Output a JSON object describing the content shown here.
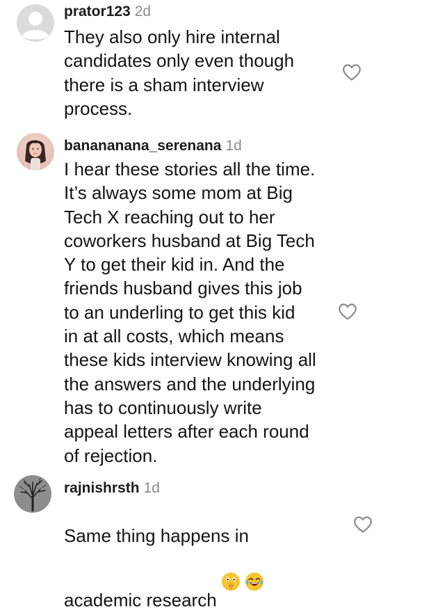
{
  "comments": [
    {
      "username": "prator123",
      "time": "2d",
      "text": "They also only hire internal\ncandidates only even though\nthere is a sham interview\nprocess.",
      "avatar_icon": "default-avatar-icon",
      "like_icon": "heart-outline-icon"
    },
    {
      "username": "banananana_serenana",
      "time": "1d",
      "text": "I hear these stories all the time.\nIt’s always some mom at Big\nTech X reaching out to her\ncoworkers husband at Big Tech\nY to get their kid in. And the\nfriends husband gives this job\nto an underling to get this kid\nin at all costs, which means\nthese kids interview knowing all\nthe answers and the underlying\nhas to continuously write\nappeal letters after each round\nof rejection.",
      "avatar_icon": "profile-photo-avatar",
      "like_icon": "heart-outline-icon"
    },
    {
      "username": "rajnishrsth",
      "time": "1d",
      "text": "Same thing happens in\nacademic research",
      "emojis": [
        "shushing-face-emoji",
        "tears-of-joy-emoji"
      ],
      "avatar_icon": "tree-photo-avatar",
      "like_icon": "heart-outline-icon"
    }
  ],
  "colors": {
    "text": "#141414",
    "muted": "#8a8a8a",
    "default_avatar_bg": "#dbdbdb",
    "default_avatar_fg": "#ffffff"
  }
}
